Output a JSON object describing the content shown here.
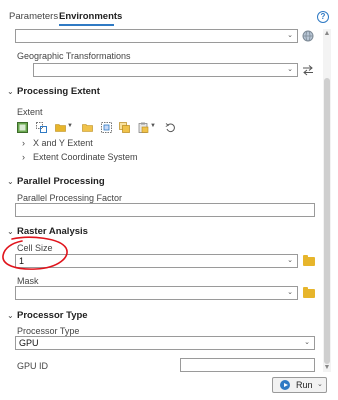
{
  "tabs": [
    {
      "label": "Parameters"
    },
    {
      "label": "Environments"
    }
  ],
  "help_icon_text": "?",
  "top_field": {
    "value": ""
  },
  "geographic_transformations": {
    "label": "Geographic Transformations",
    "value": ""
  },
  "processing_extent": {
    "title": "Processing Extent",
    "extent_label": "Extent",
    "toolbar_icons": [
      "current-display-extent-icon",
      "intersection-extent-icon",
      "layer-folder-icon",
      "browse-folder-icon",
      "union-extent-icon",
      "copy-extent-icon",
      "paste-extent-icon",
      "reset-extent-icon"
    ],
    "sub_items": [
      {
        "label": "X and Y Extent"
      },
      {
        "label": "Extent Coordinate System"
      }
    ]
  },
  "parallel_processing": {
    "title": "Parallel Processing",
    "factor_label": "Parallel Processing Factor",
    "factor_value": ""
  },
  "raster_analysis": {
    "title": "Raster Analysis",
    "cell_size_label": "Cell Size",
    "cell_size_value": "1",
    "mask_label": "Mask",
    "mask_value": ""
  },
  "processor_type": {
    "title": "Processor Type",
    "type_label": "Processor Type",
    "type_value": "GPU",
    "gpu_id_label": "GPU ID",
    "gpu_id_value": ""
  },
  "run_button": {
    "label": "Run"
  },
  "colors": {
    "accent": "#2f7ac4",
    "annotation": "#e0141c",
    "folder": "#e7b52b"
  }
}
